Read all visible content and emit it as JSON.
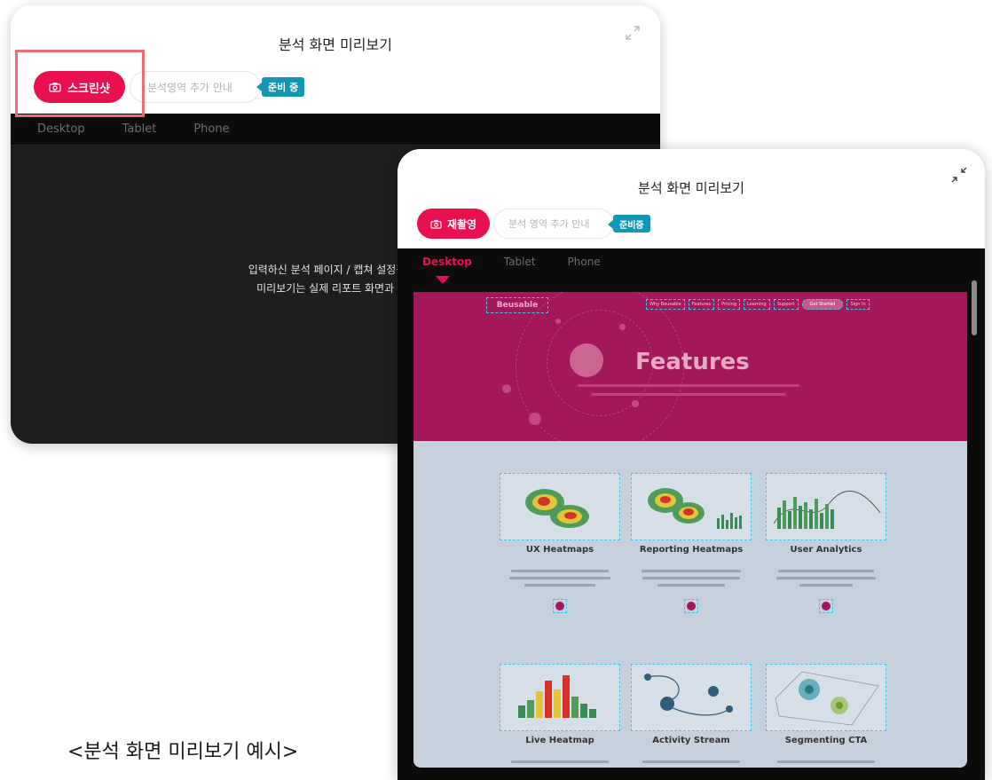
{
  "colors": {
    "accent": "#e8104f",
    "badge": "#1296b6",
    "highlight_frame": "#f26b74",
    "hero": "#a3185a"
  },
  "back_panel": {
    "title": "분석 화면 미리보기",
    "screenshot_button": "스크린샷",
    "guide_pill": "분석영역 추가 안내",
    "badge": "준비 중",
    "tabs": [
      "Desktop",
      "Tablet",
      "Phone"
    ],
    "message_line1": "입력하신 분석 페이지 / 캡쳐 설정값과 촬영",
    "message_line2": "미리보기는 실제 리포트 화면과 다를 수",
    "corner_icon": "expand-icon"
  },
  "front_panel": {
    "title": "분석 화면 미리보기",
    "retake_button": "재촬영",
    "guide_pill": "분석 영역 추가 안내",
    "badge": "준비중",
    "tabs": [
      "Desktop",
      "Tablet",
      "Phone"
    ],
    "active_tab": "Desktop",
    "corner_icon": "collapse-icon",
    "preview": {
      "logo": "Beusable",
      "nav": [
        "Why Beusable",
        "Features",
        "Pricing",
        "Learning",
        "Support",
        "Get Started",
        "Sign In"
      ],
      "hero_title": "Features",
      "cards": [
        {
          "title": "UX Heatmaps"
        },
        {
          "title": "Reporting Heatmaps"
        },
        {
          "title": "User Analytics"
        },
        {
          "title": "Live Heatmap"
        },
        {
          "title": "Activity Stream"
        },
        {
          "title": "Segmenting CTA"
        }
      ]
    }
  },
  "caption": "<분석 화면 미리보기 예시>"
}
